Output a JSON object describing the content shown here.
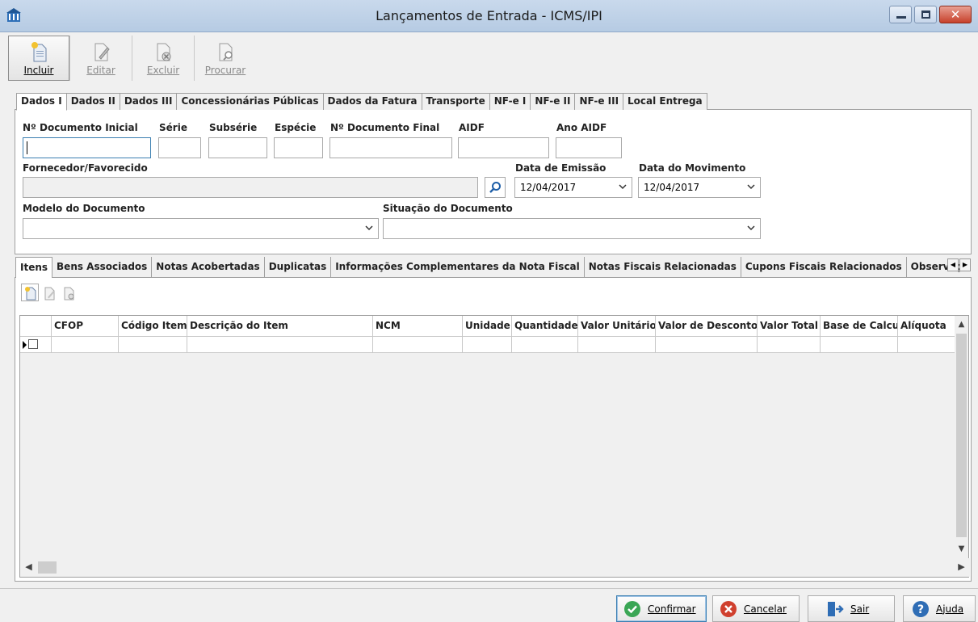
{
  "window": {
    "title": "Lançamentos de Entrada - ICMS/IPI",
    "close_glyph": "✕"
  },
  "toolbar": {
    "items": [
      {
        "label": "Incluir",
        "icon": "add-document-icon",
        "enabled": true
      },
      {
        "label": "Editar",
        "icon": "edit-document-icon",
        "enabled": false
      },
      {
        "label": "Excluir",
        "icon": "delete-document-icon",
        "enabled": false
      },
      {
        "label": "Procurar",
        "icon": "search-document-icon",
        "enabled": false
      }
    ]
  },
  "main_tabs": [
    "Dados I",
    "Dados II",
    "Dados III",
    "Concessionárias Públicas",
    "Dados da Fatura",
    "Transporte",
    "NF-e I",
    "NF-e II",
    "NF-e III",
    "Local Entrega"
  ],
  "main_tab_active": "Dados I",
  "form": {
    "doc_inicial_label": "Nº Documento Inicial",
    "doc_inicial_value": "",
    "serie_label": "Série",
    "subserie_label": "Subsérie",
    "especie_label": "Espécie",
    "doc_final_label": "Nº Documento Final",
    "aidf_label": "AIDF",
    "ano_aidf_label": "Ano AIDF",
    "fornecedor_label": "Fornecedor/Favorecido",
    "fornecedor_value": "",
    "data_emissao_label": "Data de Emissão",
    "data_emissao_value": "12/04/2017",
    "data_movimento_label": "Data do Movimento",
    "data_movimento_value": "12/04/2017",
    "modelo_label": "Modelo do Documento",
    "modelo_value": "",
    "situacao_label": "Situação do Documento",
    "situacao_value": ""
  },
  "sub_tabs": [
    "Itens",
    "Bens Associados",
    "Notas Acobertadas",
    "Duplicatas",
    "Informações Complementares da Nota Fiscal",
    "Notas Fiscais Relacionadas",
    "Cupons Fiscais Relacionados",
    "Observaçã"
  ],
  "sub_tab_active": "Itens",
  "grid": {
    "columns": [
      "CFOP",
      "Código Item",
      "Descrição do Item",
      "NCM",
      "Unidade",
      "Quantidade",
      "Valor Unitário",
      "Valor de Desconto",
      "Valor Total",
      "Base de Calculo",
      "Alíquota"
    ]
  },
  "bottom_buttons": {
    "confirmar": "Confirmar",
    "cancelar": "Cancelar",
    "sair": "Sair",
    "ajuda": "Ajuda"
  },
  "colors": {
    "title_bar": "#b6cbe3",
    "confirm_green": "#3aa655",
    "cancel_red": "#d0402e",
    "help_blue": "#2f6db5"
  }
}
